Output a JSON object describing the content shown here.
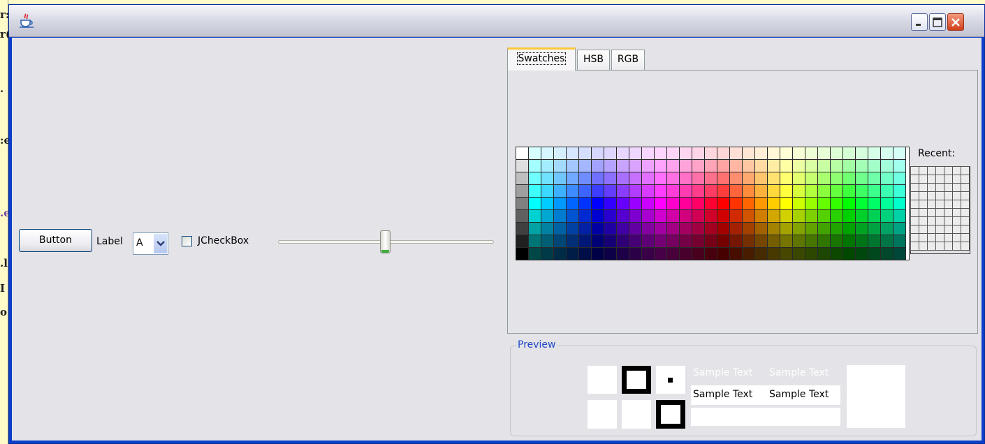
{
  "window": {
    "title": "",
    "controls": [
      "minimize",
      "maximize",
      "close"
    ]
  },
  "background_fragments": [
    "r:",
    "r(",
    ".",
    ":e",
    ".e",
    ".l",
    "I",
    "o"
  ],
  "form": {
    "button_label": "Button",
    "label_text": "Label",
    "combo_value": "A",
    "checkbox_label": "JCheckBox",
    "checkbox_checked": false,
    "slider_value": 50
  },
  "color_chooser": {
    "tabs": [
      {
        "label": "Swatches",
        "selected": true
      },
      {
        "label": "HSB",
        "selected": false
      },
      {
        "label": "RGB",
        "selected": false
      }
    ],
    "recent_label": "Recent:",
    "swatch_columns": 31,
    "swatch_rows": 9,
    "recent_columns": 7,
    "recent_rows": 10
  },
  "preview": {
    "legend": "Preview",
    "sample_text": "Sample Text",
    "colors": {
      "selected": "#ffffff",
      "black": "#000000"
    }
  }
}
